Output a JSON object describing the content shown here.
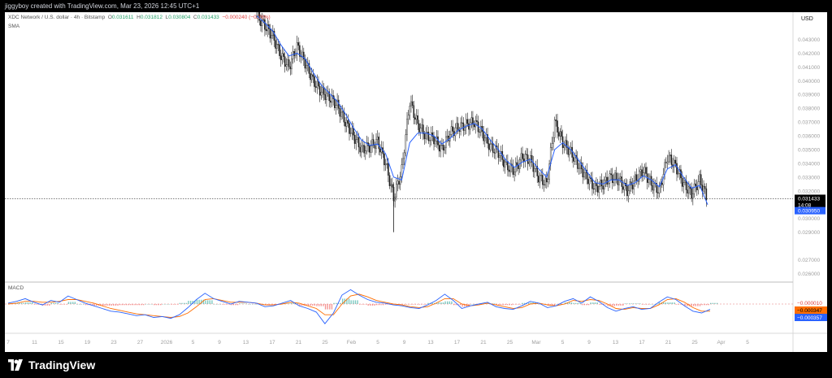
{
  "header": {
    "credit": "jiggyboy created with TradingView.com, Mar 23, 2026 12:45 UTC+1"
  },
  "legend": {
    "symbol": "XDC Network / U.S. dollar · 4h · Bitstamp",
    "open_label": "O",
    "open": "0.031611",
    "high_label": "H",
    "high": "0.031812",
    "low_label": "L",
    "low": "0.030804",
    "close_label": "C",
    "close": "0.031433",
    "change": "−0.000240 (−0.76%)",
    "indicator": "SMA",
    "macd_indicator": "MACD"
  },
  "currency": "USD",
  "price_tag": {
    "value": "0.031433",
    "timer": "14:08",
    "sma_value": "0.030950"
  },
  "macd_tags": [
    "−0.000010",
    "−0.000347",
    "−0.000357"
  ],
  "brand": "TradingView",
  "colors": {
    "candle": "#1e1e1e",
    "sma": "#2962ff",
    "macd_line": "#2962ff",
    "signal_line": "#ff6d00",
    "hist_pos": "#26a69a",
    "hist_neg": "#ef5350",
    "price_tag_bg": "#000000",
    "sma_tag_bg": "#2962ff"
  },
  "chart_data": {
    "type": "line",
    "ylim": [
      0.0255,
      0.0445
    ],
    "y_ticks": [
      0.043,
      0.042,
      0.041,
      0.04,
      0.039,
      0.038,
      0.037,
      0.036,
      0.035,
      0.034,
      0.033,
      0.032,
      0.03,
      0.029,
      0.027,
      0.026
    ],
    "y_tick_labels": [
      "0.043000",
      "0.042000",
      "0.041000",
      "0.040000",
      "0.039000",
      "0.038000",
      "0.037000",
      "0.036000",
      "0.035000",
      "0.034000",
      "0.033000",
      "0.032000",
      "0.030000",
      "0.029000",
      "0.027000",
      "0.026000"
    ],
    "x_ticks": [
      "7",
      "11",
      "15",
      "19",
      "23",
      "27",
      "2026",
      "5",
      "9",
      "13",
      "17",
      "21",
      "25",
      "Feb",
      "5",
      "9",
      "13",
      "17",
      "21",
      "25",
      "Mar",
      "5",
      "9",
      "13",
      "17",
      "21",
      "25",
      "Apr",
      "5"
    ],
    "series": [
      {
        "name": "price",
        "values": [
          0.0447,
          0.044,
          0.0432,
          0.0418,
          0.041,
          0.0425,
          0.0413,
          0.04,
          0.0392,
          0.0388,
          0.0382,
          0.037,
          0.036,
          0.035,
          0.0352,
          0.0356,
          0.034,
          0.0315,
          0.0335,
          0.0385,
          0.0368,
          0.036,
          0.0358,
          0.035,
          0.0362,
          0.0366,
          0.0368,
          0.037,
          0.0362,
          0.0352,
          0.0348,
          0.0338,
          0.0335,
          0.0345,
          0.0342,
          0.033,
          0.0325,
          0.037,
          0.0355,
          0.0348,
          0.0338,
          0.033,
          0.0322,
          0.0325,
          0.033,
          0.0328,
          0.032,
          0.0328,
          0.0335,
          0.0325,
          0.032,
          0.0345,
          0.0338,
          0.0325,
          0.0318,
          0.0328,
          0.0314
        ]
      },
      {
        "name": "SMA",
        "values": [
          0.0447,
          0.0442,
          0.0436,
          0.0426,
          0.0418,
          0.042,
          0.0416,
          0.0406,
          0.0397,
          0.0391,
          0.0385,
          0.0376,
          0.0366,
          0.0357,
          0.0353,
          0.0354,
          0.0347,
          0.033,
          0.0328,
          0.0355,
          0.0362,
          0.0362,
          0.036,
          0.0354,
          0.0358,
          0.0364,
          0.0367,
          0.0369,
          0.0365,
          0.0357,
          0.035,
          0.0342,
          0.0337,
          0.0341,
          0.0343,
          0.0336,
          0.033,
          0.035,
          0.0355,
          0.035,
          0.0342,
          0.0334,
          0.0326,
          0.0325,
          0.0328,
          0.0328,
          0.0324,
          0.0326,
          0.0331,
          0.0328,
          0.0323,
          0.0336,
          0.0339,
          0.033,
          0.0322,
          0.0324,
          0.031
        ]
      }
    ],
    "macd": {
      "macd_line": [
        0.1,
        0.3,
        0.6,
        0.2,
        -0.1,
        0.4,
        0.2,
        0.9,
        0.5,
        0.1,
        -0.2,
        -0.5,
        -0.8,
        -0.9,
        -1.1,
        -1.3,
        -1.2,
        -1.5,
        -1.4,
        -1.6,
        -1.2,
        -0.4,
        0.5,
        1.2,
        0.6,
        0.3,
        0.0,
        0.3,
        0.2,
        0.1,
        -0.3,
        -0.2,
        0.1,
        0.4,
        -0.2,
        -0.5,
        -0.9,
        -2.2,
        -1.0,
        1.0,
        1.6,
        1.0,
        0.5,
        0.2,
        0.1,
        -0.1,
        -0.2,
        -0.4,
        -0.5,
        -0.1,
        0.4,
        1.1,
        0.4,
        -0.5,
        -0.2,
        0.0,
        0.2,
        -0.3,
        -0.5,
        -0.6,
        -0.2,
        0.3,
        0.1,
        -0.4,
        -0.2,
        0.3,
        0.6,
        0.1,
        0.8,
        0.3,
        -0.4,
        -0.8,
        -0.5,
        -0.3,
        -0.6,
        -0.5,
        0.2,
        0.8,
        0.5,
        -0.2,
        -0.8,
        -1.0,
        -0.6
      ],
      "signal_line": [
        0.0,
        0.1,
        0.3,
        0.3,
        0.2,
        0.2,
        0.3,
        0.5,
        0.5,
        0.3,
        0.1,
        -0.2,
        -0.5,
        -0.7,
        -0.9,
        -1.1,
        -1.2,
        -1.3,
        -1.4,
        -1.5,
        -1.4,
        -1.0,
        -0.3,
        0.5,
        0.6,
        0.4,
        0.2,
        0.2,
        0.2,
        0.1,
        -0.1,
        -0.1,
        0.0,
        0.2,
        0.1,
        -0.2,
        -0.5,
        -1.2,
        -1.2,
        0.0,
        0.9,
        1.1,
        0.8,
        0.4,
        0.2,
        0.0,
        -0.1,
        -0.3,
        -0.4,
        -0.3,
        0.1,
        0.6,
        0.6,
        0.0,
        -0.2,
        -0.1,
        0.1,
        -0.1,
        -0.3,
        -0.5,
        -0.4,
        0.0,
        0.1,
        -0.1,
        -0.2,
        0.0,
        0.4,
        0.3,
        0.5,
        0.4,
        0.0,
        -0.5,
        -0.6,
        -0.4,
        -0.5,
        -0.5,
        -0.1,
        0.5,
        0.6,
        0.2,
        -0.4,
        -0.8,
        -0.8
      ]
    }
  }
}
